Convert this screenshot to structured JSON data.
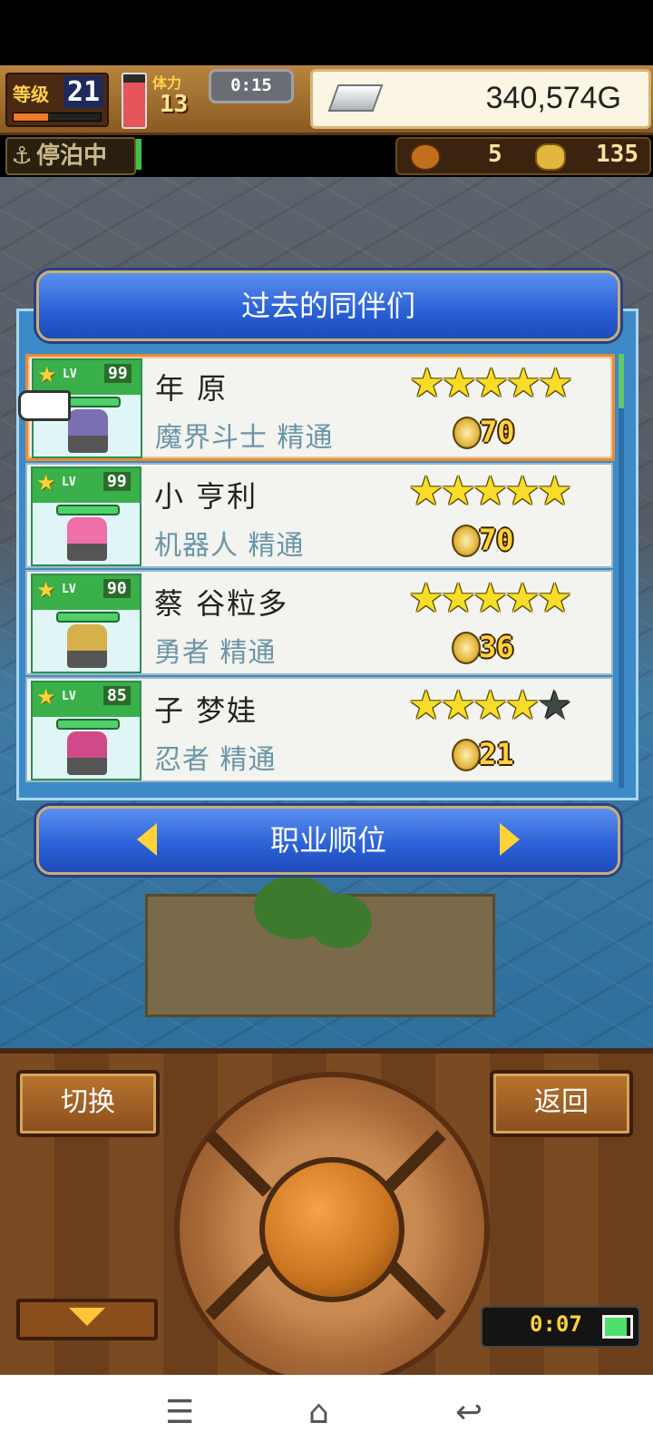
{
  "hud": {
    "level_label": "等级",
    "level_value": "21",
    "level_progress": 0.4,
    "stamina_fill": 0.85,
    "stamina_label": "体力",
    "stamina_value": "13",
    "timer": "0:15",
    "gold": "340,574G"
  },
  "status": {
    "dock": "停泊中",
    "fish_count": "5",
    "coin_count": "135"
  },
  "dialog": {
    "title": "过去的同伴们",
    "rank_button": "职业顺位"
  },
  "companions": [
    {
      "name": "年 原",
      "job": "魔界斗士 精通",
      "level": "99",
      "stars": 5,
      "coins": "70",
      "sprite_color": "#7a6fb0",
      "selected": true
    },
    {
      "name": "小 亨利",
      "job": "机器人 精通",
      "level": "99",
      "stars": 5,
      "coins": "70",
      "sprite_color": "#ef6fa8",
      "selected": false
    },
    {
      "name": "蔡 谷粒多",
      "job": "勇者 精通",
      "level": "90",
      "stars": 5,
      "coins": "36",
      "sprite_color": "#d6b04a",
      "selected": false
    },
    {
      "name": "子 梦娃",
      "job": "忍者 精通",
      "level": "85",
      "stars": 4,
      "coins": "21",
      "sprite_color": "#d04a8a",
      "selected": false
    }
  ],
  "lv_tag": "LV",
  "controls": {
    "switch": "切换",
    "back": "返回",
    "play_time": "0:07",
    "battery_level": 0.85
  },
  "icons": {
    "star": "★",
    "menu": "☰",
    "home": "⌂",
    "back": "↩",
    "anchor": "⚓"
  },
  "colors": {
    "dialog_blue": "#2a5fd6",
    "row_selected_border": "#ee8a2e",
    "star_gold": "#f7dd2a",
    "job_text": "#6b96a8"
  }
}
